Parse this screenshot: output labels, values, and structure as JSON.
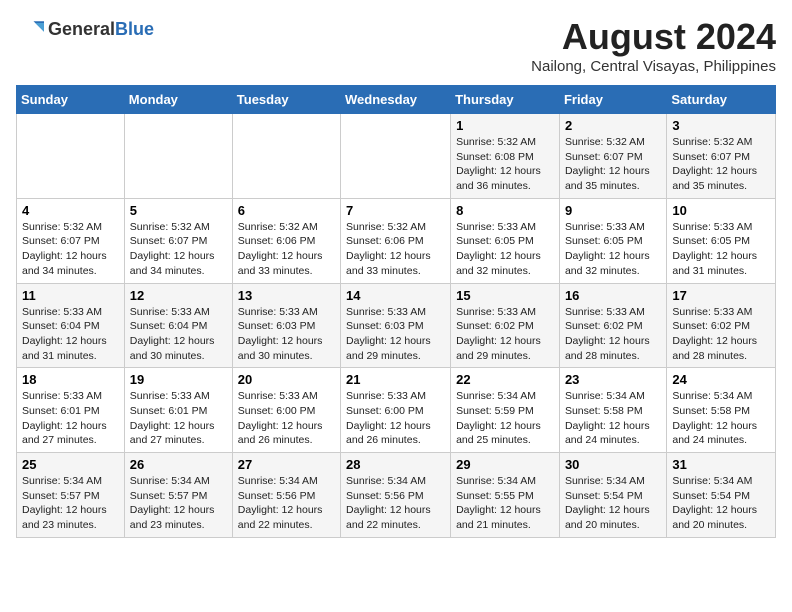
{
  "header": {
    "logo_line1": "General",
    "logo_line2": "Blue",
    "month_year": "August 2024",
    "location": "Nailong, Central Visayas, Philippines"
  },
  "days_of_week": [
    "Sunday",
    "Monday",
    "Tuesday",
    "Wednesday",
    "Thursday",
    "Friday",
    "Saturday"
  ],
  "weeks": [
    [
      {
        "day": "",
        "text": ""
      },
      {
        "day": "",
        "text": ""
      },
      {
        "day": "",
        "text": ""
      },
      {
        "day": "",
        "text": ""
      },
      {
        "day": "1",
        "text": "Sunrise: 5:32 AM\nSunset: 6:08 PM\nDaylight: 12 hours and 36 minutes."
      },
      {
        "day": "2",
        "text": "Sunrise: 5:32 AM\nSunset: 6:07 PM\nDaylight: 12 hours and 35 minutes."
      },
      {
        "day": "3",
        "text": "Sunrise: 5:32 AM\nSunset: 6:07 PM\nDaylight: 12 hours and 35 minutes."
      }
    ],
    [
      {
        "day": "4",
        "text": "Sunrise: 5:32 AM\nSunset: 6:07 PM\nDaylight: 12 hours and 34 minutes."
      },
      {
        "day": "5",
        "text": "Sunrise: 5:32 AM\nSunset: 6:07 PM\nDaylight: 12 hours and 34 minutes."
      },
      {
        "day": "6",
        "text": "Sunrise: 5:32 AM\nSunset: 6:06 PM\nDaylight: 12 hours and 33 minutes."
      },
      {
        "day": "7",
        "text": "Sunrise: 5:32 AM\nSunset: 6:06 PM\nDaylight: 12 hours and 33 minutes."
      },
      {
        "day": "8",
        "text": "Sunrise: 5:33 AM\nSunset: 6:05 PM\nDaylight: 12 hours and 32 minutes."
      },
      {
        "day": "9",
        "text": "Sunrise: 5:33 AM\nSunset: 6:05 PM\nDaylight: 12 hours and 32 minutes."
      },
      {
        "day": "10",
        "text": "Sunrise: 5:33 AM\nSunset: 6:05 PM\nDaylight: 12 hours and 31 minutes."
      }
    ],
    [
      {
        "day": "11",
        "text": "Sunrise: 5:33 AM\nSunset: 6:04 PM\nDaylight: 12 hours and 31 minutes."
      },
      {
        "day": "12",
        "text": "Sunrise: 5:33 AM\nSunset: 6:04 PM\nDaylight: 12 hours and 30 minutes."
      },
      {
        "day": "13",
        "text": "Sunrise: 5:33 AM\nSunset: 6:03 PM\nDaylight: 12 hours and 30 minutes."
      },
      {
        "day": "14",
        "text": "Sunrise: 5:33 AM\nSunset: 6:03 PM\nDaylight: 12 hours and 29 minutes."
      },
      {
        "day": "15",
        "text": "Sunrise: 5:33 AM\nSunset: 6:02 PM\nDaylight: 12 hours and 29 minutes."
      },
      {
        "day": "16",
        "text": "Sunrise: 5:33 AM\nSunset: 6:02 PM\nDaylight: 12 hours and 28 minutes."
      },
      {
        "day": "17",
        "text": "Sunrise: 5:33 AM\nSunset: 6:02 PM\nDaylight: 12 hours and 28 minutes."
      }
    ],
    [
      {
        "day": "18",
        "text": "Sunrise: 5:33 AM\nSunset: 6:01 PM\nDaylight: 12 hours and 27 minutes."
      },
      {
        "day": "19",
        "text": "Sunrise: 5:33 AM\nSunset: 6:01 PM\nDaylight: 12 hours and 27 minutes."
      },
      {
        "day": "20",
        "text": "Sunrise: 5:33 AM\nSunset: 6:00 PM\nDaylight: 12 hours and 26 minutes."
      },
      {
        "day": "21",
        "text": "Sunrise: 5:33 AM\nSunset: 6:00 PM\nDaylight: 12 hours and 26 minutes."
      },
      {
        "day": "22",
        "text": "Sunrise: 5:34 AM\nSunset: 5:59 PM\nDaylight: 12 hours and 25 minutes."
      },
      {
        "day": "23",
        "text": "Sunrise: 5:34 AM\nSunset: 5:58 PM\nDaylight: 12 hours and 24 minutes."
      },
      {
        "day": "24",
        "text": "Sunrise: 5:34 AM\nSunset: 5:58 PM\nDaylight: 12 hours and 24 minutes."
      }
    ],
    [
      {
        "day": "25",
        "text": "Sunrise: 5:34 AM\nSunset: 5:57 PM\nDaylight: 12 hours and 23 minutes."
      },
      {
        "day": "26",
        "text": "Sunrise: 5:34 AM\nSunset: 5:57 PM\nDaylight: 12 hours and 23 minutes."
      },
      {
        "day": "27",
        "text": "Sunrise: 5:34 AM\nSunset: 5:56 PM\nDaylight: 12 hours and 22 minutes."
      },
      {
        "day": "28",
        "text": "Sunrise: 5:34 AM\nSunset: 5:56 PM\nDaylight: 12 hours and 22 minutes."
      },
      {
        "day": "29",
        "text": "Sunrise: 5:34 AM\nSunset: 5:55 PM\nDaylight: 12 hours and 21 minutes."
      },
      {
        "day": "30",
        "text": "Sunrise: 5:34 AM\nSunset: 5:54 PM\nDaylight: 12 hours and 20 minutes."
      },
      {
        "day": "31",
        "text": "Sunrise: 5:34 AM\nSunset: 5:54 PM\nDaylight: 12 hours and 20 minutes."
      }
    ]
  ]
}
